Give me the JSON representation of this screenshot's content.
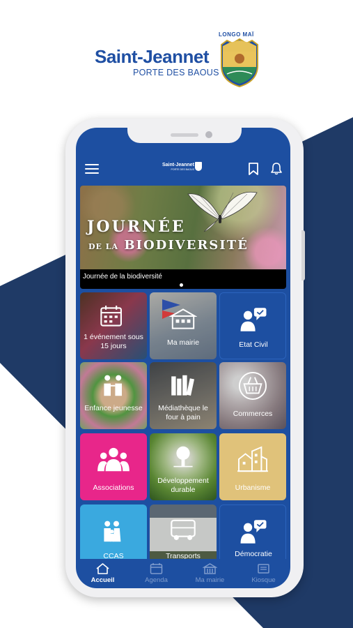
{
  "brand": {
    "name": "Saint-Jeannet",
    "tagline": "PORTE DES BAOUS",
    "motto": "LONGO MAÏ"
  },
  "app": {
    "header_logo_name": "Saint-Jeannet",
    "header_logo_sub": "PORTE DES BAOUS",
    "primary_color": "#1d4fa1",
    "carousel": {
      "title_line1": "JOURNÉE",
      "title_line2_small": "DE LA",
      "title_line2_big": "BIODIVERSITÉ",
      "caption": "Journée de la biodiversité",
      "active_index": 1
    },
    "tiles": [
      {
        "label": "1 événement sous 15 jours",
        "type": "photo",
        "icon": "calendar-icon"
      },
      {
        "label": "Ma mairie",
        "type": "photo",
        "icon": "town-hall-icon"
      },
      {
        "label": "Etat Civil",
        "type": "color",
        "color": "#1d4fa1",
        "icon": "person-chat-icon"
      },
      {
        "label": "Enfance jeunesse",
        "type": "photo",
        "icon": "children-icon"
      },
      {
        "label": "Médiathèque le four à pain",
        "type": "photo",
        "icon": "books-icon"
      },
      {
        "label": "Commerces",
        "type": "photo",
        "icon": "basket-icon"
      },
      {
        "label": "Associations",
        "type": "color",
        "color": "#e8268a",
        "icon": "group-icon"
      },
      {
        "label": "Développement durable",
        "type": "photo",
        "icon": "tree-icon"
      },
      {
        "label": "Urbanisme",
        "type": "color",
        "color": "#e0c27a",
        "icon": "buildings-icon"
      },
      {
        "label": "CCAS",
        "type": "color",
        "color": "#3aa9df",
        "icon": "family-icon"
      },
      {
        "label": "Transports",
        "type": "photo",
        "icon": "van-icon"
      },
      {
        "label": "Démocratie",
        "type": "color",
        "color": "#1d4fa1",
        "icon": "person-chat-icon"
      }
    ],
    "tabs": [
      {
        "label": "Accueil",
        "icon": "home-icon",
        "active": true
      },
      {
        "label": "Agenda",
        "icon": "calendar-icon",
        "active": false
      },
      {
        "label": "Ma mairie",
        "icon": "town-hall-icon",
        "active": false
      },
      {
        "label": "Kiosque",
        "icon": "newspaper-icon",
        "active": false
      }
    ]
  }
}
